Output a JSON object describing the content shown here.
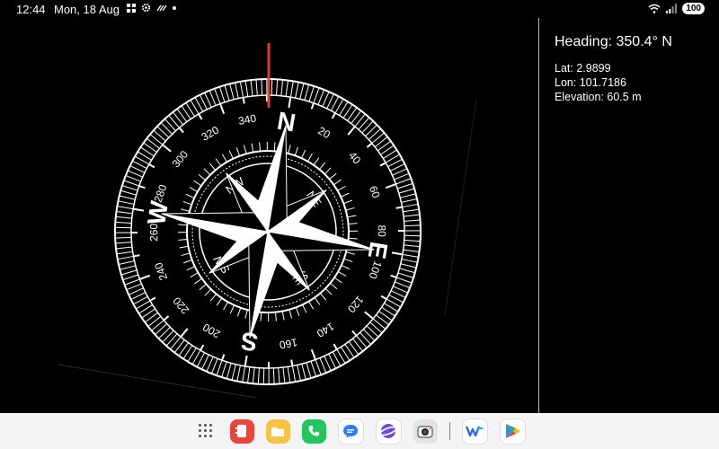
{
  "status_bar": {
    "time": "12:44",
    "date": "Mon, 18 Aug",
    "battery": "100"
  },
  "compass": {
    "cardinals": {
      "n": "N",
      "e": "E",
      "s": "S",
      "w": "W"
    },
    "intercardinals": {
      "ne": "NE",
      "se": "SE",
      "sw": "SW",
      "nw": "NW"
    },
    "degree_labels": [
      "20",
      "40",
      "60",
      "80",
      "100",
      "120",
      "140",
      "160",
      "200",
      "220",
      "240",
      "260",
      "280",
      "300",
      "320",
      "340"
    ],
    "heading_degrees": 350.4
  },
  "info": {
    "heading": "Heading: 350.4° N",
    "lat": "Lat: 2.9899",
    "lon": "Lon: 101.7186",
    "elevation": "Elevation: 60.5 m"
  },
  "dock": {
    "apps": [
      {
        "name": "app-drawer"
      },
      {
        "name": "notes-app",
        "color": "#e8463c"
      },
      {
        "name": "files-app",
        "color": "#f6c343"
      },
      {
        "name": "phone-app",
        "color": "#22c55e"
      },
      {
        "name": "messages-app",
        "color": "#2e7cf6"
      },
      {
        "name": "internet-app",
        "color": "#6d4fd6"
      },
      {
        "name": "camera-app",
        "color": "#d9d9d9"
      },
      {
        "name": "wps-app",
        "color": "#2f6df6"
      },
      {
        "name": "play-store-app",
        "color": "#34a853"
      }
    ]
  }
}
